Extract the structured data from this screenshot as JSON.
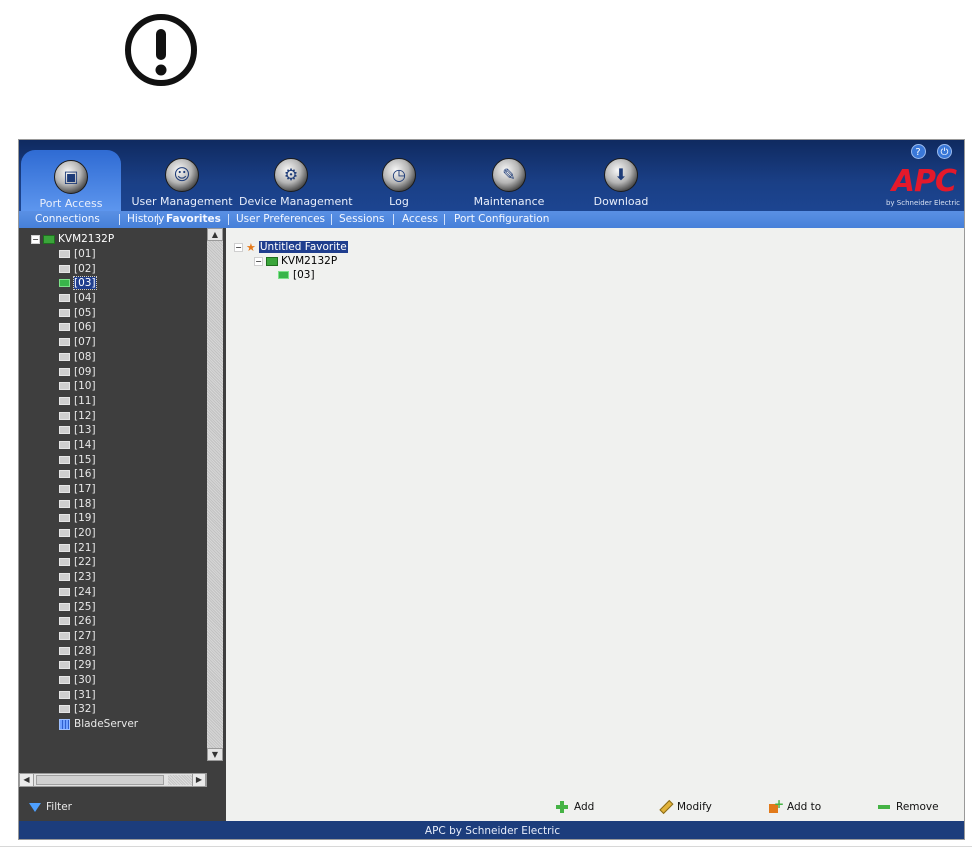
{
  "header": {
    "nav_tabs": [
      {
        "label": "Port Access",
        "icon": "port-access-icon",
        "active": true
      },
      {
        "label": "User Management",
        "icon": "user-management-icon"
      },
      {
        "label": "Device Management",
        "icon": "device-management-icon"
      },
      {
        "label": "Log",
        "icon": "log-icon"
      },
      {
        "label": "Maintenance",
        "icon": "maintenance-icon"
      },
      {
        "label": "Download",
        "icon": "download-icon"
      }
    ],
    "help_glyph": "?",
    "logout_glyph": "⏻",
    "logo_text": "APC",
    "logo_subtext": "by Schneider Electric"
  },
  "subnav": [
    {
      "label": "Connections"
    },
    {
      "label": "History"
    },
    {
      "label": "Favorites",
      "active": true
    },
    {
      "label": "User Preferences"
    },
    {
      "label": "Sessions"
    },
    {
      "label": "Access"
    },
    {
      "label": "Port Configuration"
    }
  ],
  "tree": {
    "root_label": "KVM2132P",
    "ports": [
      "[01]",
      "[02]",
      "[03]",
      "[04]",
      "[05]",
      "[06]",
      "[07]",
      "[08]",
      "[09]",
      "[10]",
      "[11]",
      "[12]",
      "[13]",
      "[14]",
      "[15]",
      "[16]",
      "[17]",
      "[18]",
      "[19]",
      "[20]",
      "[21]",
      "[22]",
      "[23]",
      "[24]",
      "[25]",
      "[26]",
      "[27]",
      "[28]",
      "[29]",
      "[30]",
      "[31]",
      "[32]"
    ],
    "selected_port": "[03]",
    "blade_label": "BladeServer"
  },
  "filter": {
    "label": "Filter"
  },
  "favorites": {
    "title": "Untitled Favorite",
    "device": "KVM2132P",
    "port": "[03]"
  },
  "actions": {
    "add": "Add",
    "modify": "Modify",
    "add_to": "Add to",
    "remove": "Remove"
  },
  "footer": {
    "text": "APC by Schneider Electric"
  },
  "colors": {
    "header": "#1a3f86",
    "subnav": "#4680d9",
    "logo": "#e4192b",
    "footer": "#1c3d7c"
  }
}
